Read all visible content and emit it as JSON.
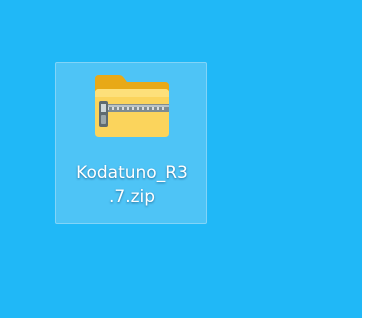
{
  "desktop": {
    "background_color": "#20b8f7",
    "items": [
      {
        "label_line1": "Kodatuno_R3",
        "label_line2": ".7.zip",
        "icon": "zip-folder-icon",
        "selected": true
      }
    ]
  }
}
